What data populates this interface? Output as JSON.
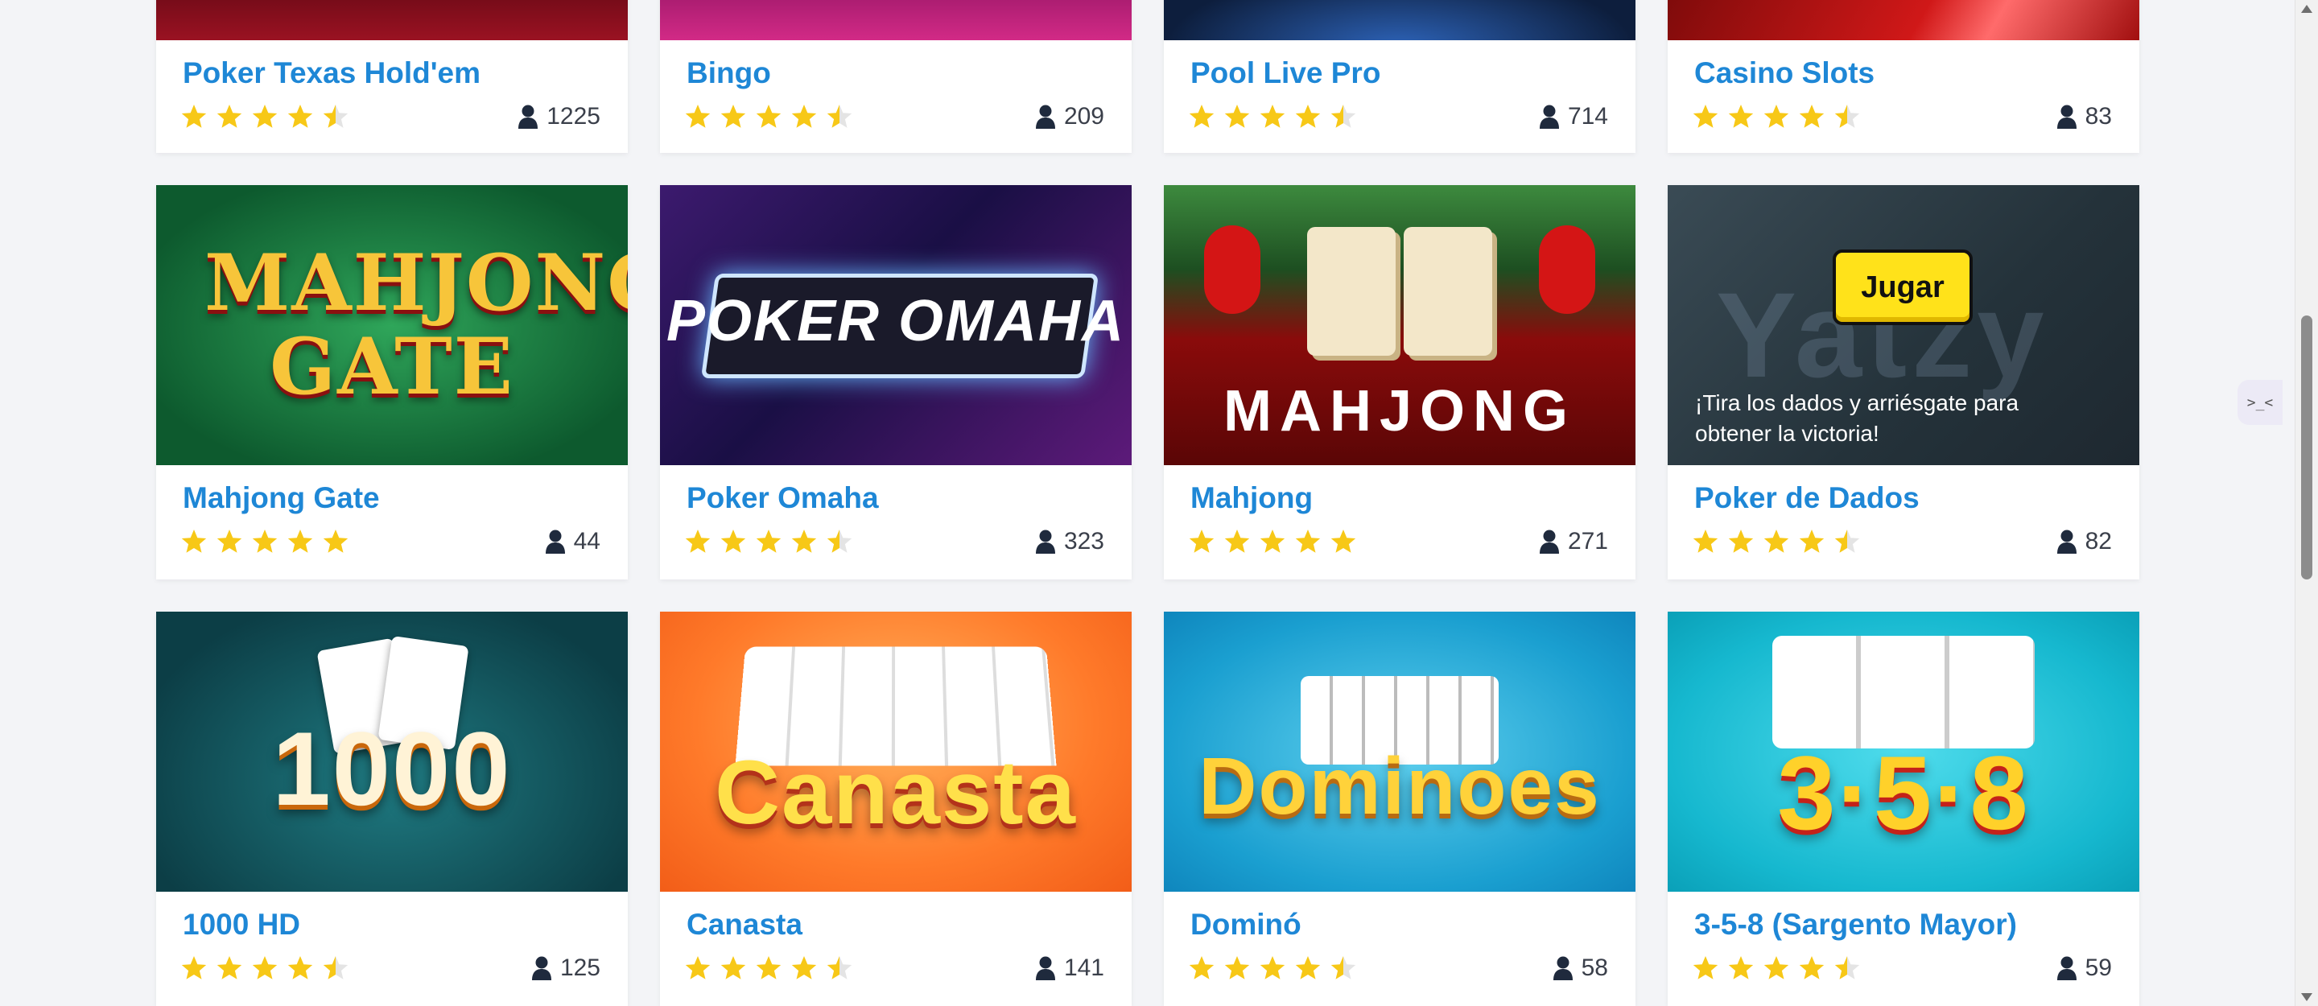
{
  "games": [
    {
      "name": "Poker Texas Hold'em",
      "stars": 4.5,
      "players": "1225",
      "thumb": "poker-texas-thumbnail"
    },
    {
      "name": "Bingo",
      "stars": 4.5,
      "players": "209",
      "thumb": "bingo-thumbnail"
    },
    {
      "name": "Pool Live Pro",
      "stars": 4.5,
      "players": "714",
      "thumb": "pool-live-pro-thumbnail"
    },
    {
      "name": "Casino Slots",
      "stars": 4.5,
      "players": "83",
      "thumb": "casino-slots-thumbnail"
    },
    {
      "name": "Mahjong Gate",
      "stars": 5,
      "players": "44",
      "thumb": "mahjong-gate-thumbnail",
      "art": "MAHJONG GATE"
    },
    {
      "name": "Poker Omaha",
      "stars": 4.5,
      "players": "323",
      "thumb": "poker-omaha-thumbnail",
      "art": "POKER OMAHA"
    },
    {
      "name": "Mahjong",
      "stars": 5,
      "players": "271",
      "thumb": "mahjong-thumbnail",
      "art": "MAHJONG"
    },
    {
      "name": "Poker de Dados",
      "stars": 4.5,
      "players": "82",
      "thumb": "poker-de-dados-thumbnail",
      "hover_button": "Jugar",
      "hover_text": "¡Tira los dados y arriésgate para obtener la victoria!",
      "watermark": "Yatzy"
    },
    {
      "name": "1000 HD",
      "stars": 4.5,
      "players": "125",
      "thumb": "1000-hd-thumbnail",
      "art": "1000"
    },
    {
      "name": "Canasta",
      "stars": 4.5,
      "players": "141",
      "thumb": "canasta-thumbnail",
      "art": "Canasta"
    },
    {
      "name": "Dominó",
      "stars": 4.5,
      "players": "58",
      "thumb": "domino-thumbnail",
      "art": "Dominoes"
    },
    {
      "name": "3-5-8 (Sargento Mayor)",
      "stars": 4.5,
      "players": "59",
      "thumb": "3-5-8-thumbnail",
      "art": "3·5·8"
    }
  ],
  "icons": {
    "player": "user-icon",
    "star": "star-icon",
    "side_tab": "side-panel-toggle-icon"
  },
  "colors": {
    "title": "#1e87d6",
    "star_full": "#f7c817",
    "star_empty": "#e4e4e4",
    "text": "#3a3f4a"
  },
  "side_tab_label": ">_<"
}
